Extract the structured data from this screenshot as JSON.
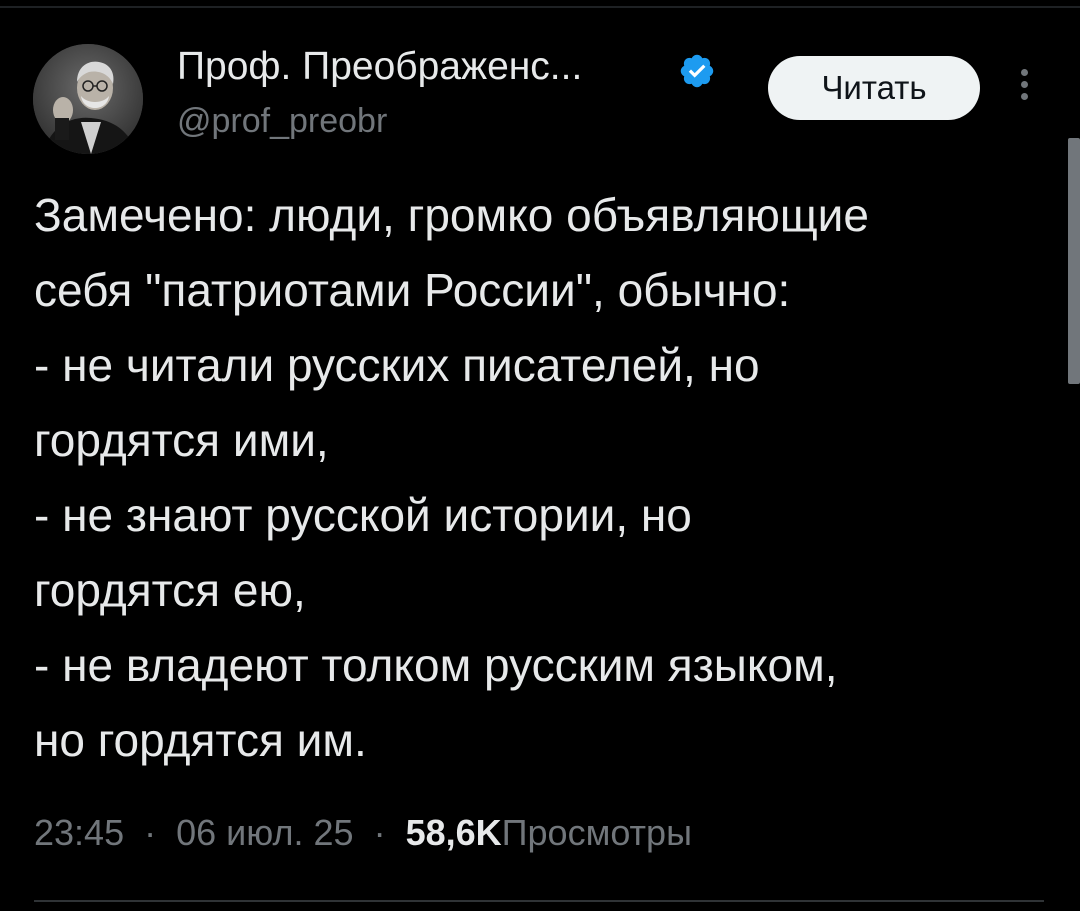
{
  "author": {
    "display_name": "Проф. Преображенс...",
    "handle": "@prof_preobr",
    "verified_icon": "verified-badge-icon",
    "verified_color": "#1d9bf0"
  },
  "follow_button": {
    "label": "Читать"
  },
  "more_menu": {
    "icon": "more-vertical-icon"
  },
  "tweet": {
    "lines": [
      "Замечено: люди, громко объявляющие",
      "себя \"патриотами России\", обычно:",
      "- не читали русских писателей, но",
      "гордятся ими,",
      "- не знают русской истории, но",
      "гордятся ею,",
      "- не владеют толком русским языком,",
      "но гордятся им."
    ]
  },
  "meta": {
    "time": "23:45",
    "separator": "·",
    "date": "06 июл. 25",
    "views_count": "58,6K",
    "views_label": "Просмотры"
  },
  "colors": {
    "background": "#000000",
    "text_primary": "#e7e9ea",
    "text_secondary": "#71767b",
    "button_bg": "#eff3f4",
    "button_text": "#0f1419"
  }
}
